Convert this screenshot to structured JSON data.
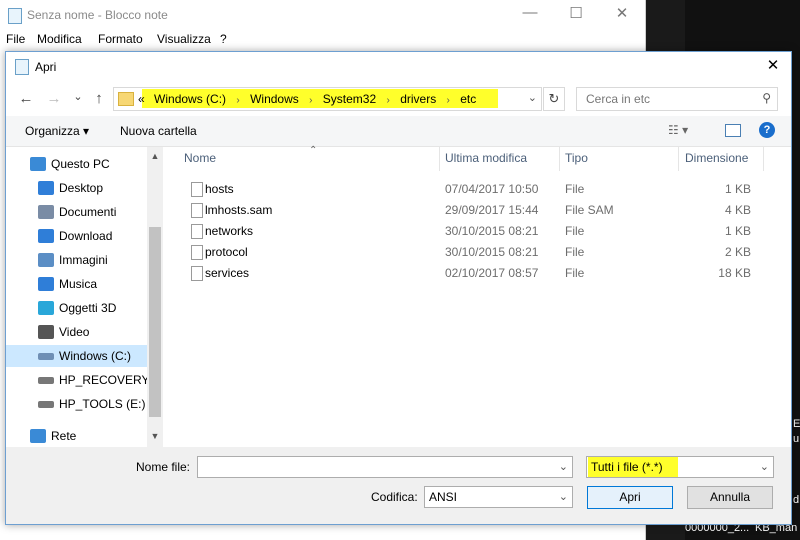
{
  "notepad": {
    "title": "Senza nome - Blocco note",
    "menu": [
      "File",
      "Modifica",
      "Formato",
      "Visualizza",
      "?"
    ],
    "min": "—",
    "max": "☐",
    "close": "✕"
  },
  "desktop": {
    "fragments": [
      "E",
      "u",
      "d",
      "0000000_2...",
      "KB_man"
    ]
  },
  "dialog": {
    "title": "Apri",
    "close": "✕",
    "nav": {
      "back": "←",
      "forward": "→",
      "recent": "⌄",
      "up": "↑"
    },
    "address": {
      "prefix": "«",
      "crumbs": [
        "Windows  (C:)",
        "Windows",
        "System32",
        "drivers",
        "etc"
      ],
      "separator": "›",
      "dropdown": "⌄",
      "refresh": "↻"
    },
    "search": {
      "placeholder": "Cerca in etc",
      "icon": "⚲"
    },
    "toolbar": {
      "organize": "Organizza ▾",
      "new_folder": "Nuova cartella",
      "view_icon": "☷ ▾",
      "help": "?"
    },
    "navpane": [
      {
        "label": "Questo PC",
        "icon": "computer-icon",
        "color": "#3a8ad6"
      },
      {
        "label": "Desktop",
        "icon": "desktop-icon",
        "color": "#2f7ed8"
      },
      {
        "label": "Documenti",
        "icon": "documents-icon",
        "color": "#7a8ca5"
      },
      {
        "label": "Download",
        "icon": "download-icon",
        "color": "#2f7ed8"
      },
      {
        "label": "Immagini",
        "icon": "pictures-icon",
        "color": "#5b8ec5"
      },
      {
        "label": "Musica",
        "icon": "music-icon",
        "color": "#2f7ed8"
      },
      {
        "label": "Oggetti 3D",
        "icon": "objects-3d-icon",
        "color": "#29a7d9"
      },
      {
        "label": "Video",
        "icon": "video-icon",
        "color": "#555555"
      },
      {
        "label": "Windows  (C:)",
        "icon": "drive-c-icon",
        "color": "#6f8fb5",
        "selected": true
      },
      {
        "label": "HP_RECOVERY (",
        "icon": "drive-icon",
        "color": "#777777"
      },
      {
        "label": "HP_TOOLS (E:)",
        "icon": "drive-icon",
        "color": "#777777"
      },
      {
        "label": "Rete",
        "icon": "network-icon",
        "color": "#3a8ad6"
      }
    ],
    "columns": {
      "name": "Nome",
      "modified": "Ultima modifica",
      "type": "Tipo",
      "size": "Dimensione",
      "sort_arrow": "⌃"
    },
    "files": [
      {
        "name": "hosts",
        "modified": "07/04/2017 10:50",
        "type": "File",
        "size": "1 KB"
      },
      {
        "name": "lmhosts.sam",
        "modified": "29/09/2017 15:44",
        "type": "File SAM",
        "size": "4 KB"
      },
      {
        "name": "networks",
        "modified": "30/10/2015 08:21",
        "type": "File",
        "size": "1 KB"
      },
      {
        "name": "protocol",
        "modified": "30/10/2015 08:21",
        "type": "File",
        "size": "2 KB"
      },
      {
        "name": "services",
        "modified": "02/10/2017 08:57",
        "type": "File",
        "size": "18 KB"
      }
    ],
    "scroll": {
      "up": "▲",
      "down": "▼"
    },
    "bottom": {
      "filename_label": "Nome file:",
      "filename_value": "",
      "filter_value": "Tutti i file  (*.*)",
      "encoding_label": "Codifica:",
      "encoding_value": "ANSI",
      "dropdown": "⌄",
      "open": "Apri",
      "cancel": "Annulla"
    },
    "highlight_color": "#ffff2b"
  }
}
